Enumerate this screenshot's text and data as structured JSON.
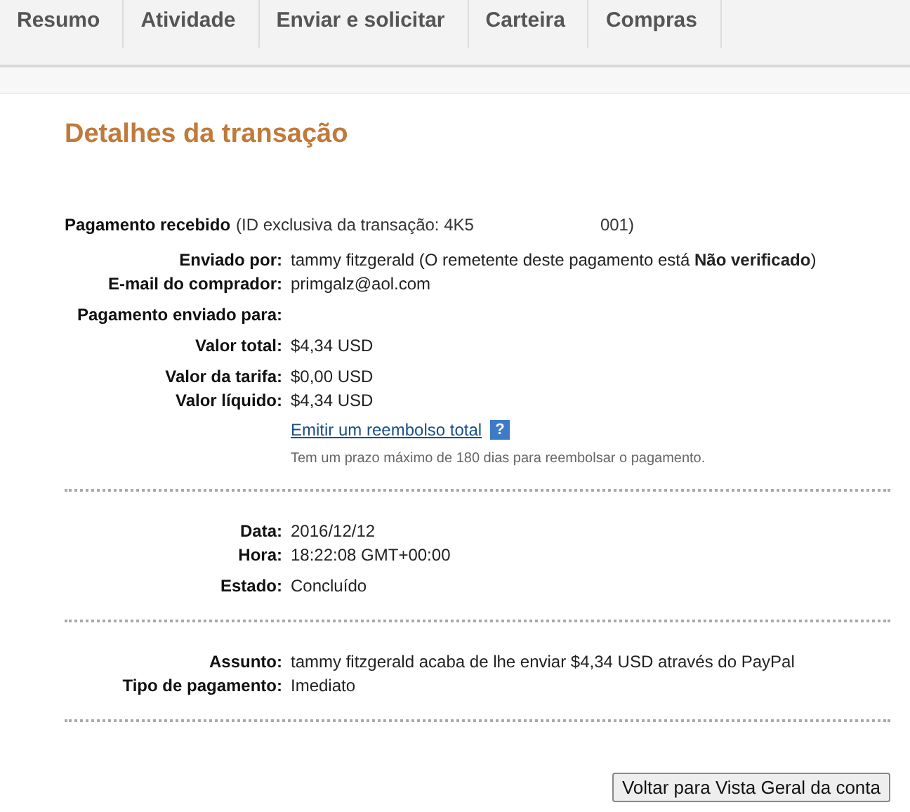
{
  "tabs": [
    {
      "label": "Resumo",
      "selected": false
    },
    {
      "label": "Atividade",
      "selected": false
    },
    {
      "label": "Enviar e solicitar",
      "selected": false
    },
    {
      "label": "Carteira",
      "selected": false
    },
    {
      "label": "Compras",
      "selected": false
    }
  ],
  "title": "Detalhes da transação",
  "payment_header": {
    "label": "Pagamento recebido",
    "id_text": "(ID exclusiva da transação: 4K5",
    "id_tail": "001)"
  },
  "sections": [
    {
      "groups": [
        [
          {
            "label": "Enviado por:",
            "value": "tammy fitzgerald (O remetente deste pagamento está **Não verificado**)"
          },
          {
            "label": "E-mail do comprador:",
            "value": "primgalz@aol.com"
          }
        ],
        [
          {
            "label": "Pagamento enviado para:"
          }
        ],
        [
          {
            "label": "Valor total:",
            "value": "$4,34 USD"
          }
        ],
        [
          {
            "label": "Valor da tarifa:",
            "value": "$0,00 USD"
          },
          {
            "label": "Valor líquido:",
            "value": "$4,34 USD"
          }
        ]
      ],
      "refund": {
        "link": "Emitir um reembolso total",
        "help": "?",
        "note": "Tem um prazo máximo de 180 dias para reembolsar o pagamento."
      }
    },
    {
      "groups": [
        [
          {
            "label": "Data:",
            "value": "2016/12/12"
          },
          {
            "label": "Hora:",
            "value": "18:22:08 GMT+00:00"
          }
        ],
        [
          {
            "label": "Estado:",
            "value": "Concluído"
          }
        ]
      ]
    },
    {
      "groups": [
        [
          {
            "label": "Assunto:",
            "value": "tammy fitzgerald acaba de lhe enviar $4,34 USD através do PayPal"
          },
          {
            "label": "Tipo de pagamento:",
            "value": "Imediato"
          }
        ]
      ]
    }
  ],
  "button": "Voltar para Vista Geral da conta"
}
